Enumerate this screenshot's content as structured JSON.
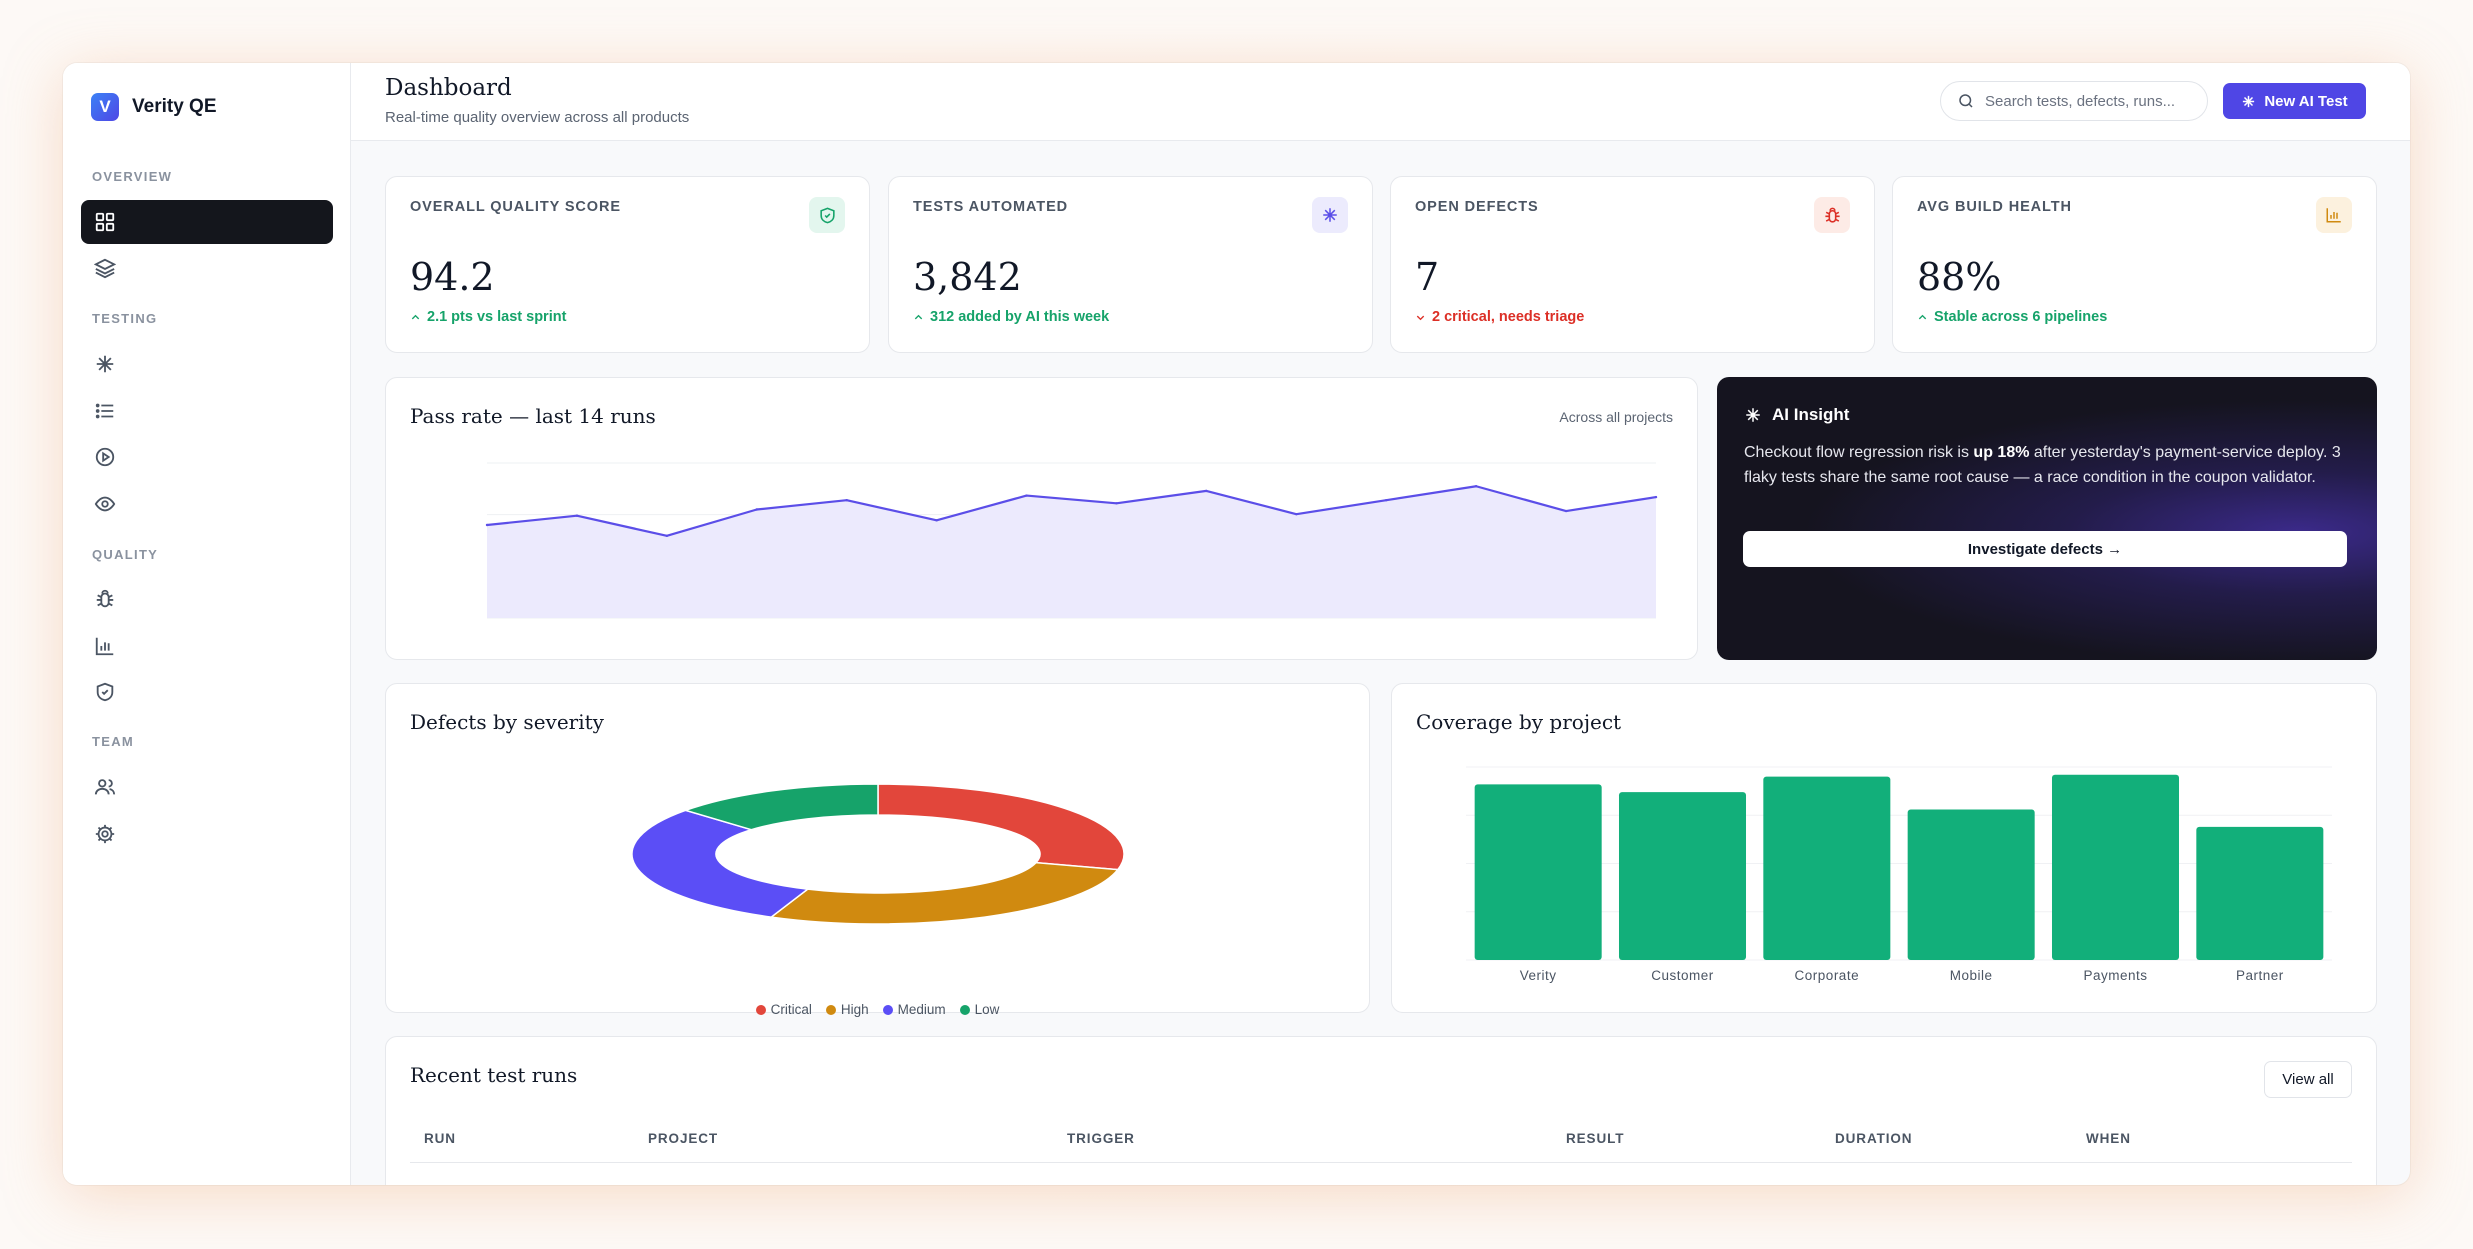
{
  "brand": {
    "name": "Verity QE",
    "logo_letter": "V"
  },
  "sidebar": {
    "sections": [
      {
        "label": "OVERVIEW"
      },
      {
        "label": "TESTING"
      },
      {
        "label": "QUALITY"
      },
      {
        "label": "TEAM"
      }
    ],
    "items": [
      {
        "icon": "grid-icon",
        "active": true
      },
      {
        "icon": "layers-icon"
      },
      {
        "icon": "sparkle-icon"
      },
      {
        "icon": "list-icon"
      },
      {
        "icon": "play-circle-icon"
      },
      {
        "icon": "eye-icon"
      },
      {
        "icon": "bug-icon"
      },
      {
        "icon": "bar-chart-icon"
      },
      {
        "icon": "shield-check-icon"
      },
      {
        "icon": "users-icon"
      },
      {
        "icon": "gear-icon"
      }
    ]
  },
  "header": {
    "title": "Dashboard",
    "subtitle": "Real-time quality overview across all products",
    "search_placeholder": "Search tests, defects, runs...",
    "new_button": "New AI Test"
  },
  "kpis": [
    {
      "label": "OVERALL QUALITY SCORE",
      "value": "94.2",
      "delta": "2.1 pts vs last sprint",
      "trend": "up",
      "icon": "shield-check-icon",
      "icon_color": "#16a36a",
      "icon_bg": "#e3f6ee"
    },
    {
      "label": "TESTS AUTOMATED",
      "value": "3,842",
      "delta": "312 added by AI this week",
      "trend": "up",
      "icon": "sparkle-icon",
      "icon_color": "#5b4ee8",
      "icon_bg": "#ecebfd"
    },
    {
      "label": "OPEN DEFECTS",
      "value": "7",
      "delta": "2 critical, needs triage",
      "trend": "down",
      "icon": "bug-icon",
      "icon_color": "#dc2f26",
      "icon_bg": "#fdebe6"
    },
    {
      "label": "AVG BUILD HEALTH",
      "value": "88%",
      "delta": "Stable across 6 pipelines",
      "trend": "up",
      "icon": "bar-chart-icon",
      "icon_color": "#d08a10",
      "icon_bg": "#fcf1de"
    }
  ],
  "pass_rate": {
    "title": "Pass rate — last 14 runs",
    "meta": "Across all projects"
  },
  "insight": {
    "title": "AI Insight",
    "body_pre": "Checkout flow regression risk is ",
    "body_bold": "up 18%",
    "body_post": " after yesterday's payment-service deploy. 3 flaky tests share the same root cause — a race condition in the coupon validator.",
    "button": "Investigate defects →"
  },
  "defects": {
    "title": "Defects by severity"
  },
  "coverage": {
    "title": "Coverage by project"
  },
  "recent_runs": {
    "title": "Recent test runs",
    "view_all": "View all",
    "columns": [
      "RUN",
      "PROJECT",
      "TRIGGER",
      "RESULT",
      "DURATION",
      "WHEN"
    ]
  },
  "chart_data": [
    {
      "type": "area",
      "title": "Pass rate — last 14 runs",
      "x": [
        1,
        2,
        3,
        4,
        5,
        6,
        7,
        8,
        9,
        10,
        11,
        12,
        13,
        14
      ],
      "series": [
        {
          "values": [
            92.0,
            93.2,
            90.6,
            94.0,
            95.2,
            92.6,
            95.8,
            94.8,
            96.4,
            93.4,
            95.2,
            97.0,
            93.8,
            95.6
          ]
        }
      ],
      "ylim": [
        80,
        100
      ],
      "grid": true,
      "color": "#5b4ee8",
      "fill": "#eceafd"
    },
    {
      "type": "pie",
      "title": "Defects by severity",
      "categories": [
        "Critical",
        "High",
        "Medium",
        "Low"
      ],
      "values": [
        2,
        2,
        2,
        1
      ],
      "colors": [
        "#e2463b",
        "#d08a10",
        "#5b4ef6",
        "#16a36a"
      ],
      "donut": true,
      "legend": "bottom"
    },
    {
      "type": "bar",
      "title": "Coverage by project",
      "categories": [
        "Verity",
        "Customer",
        "Corporate",
        "Mobile",
        "Payments",
        "Partner"
      ],
      "values": [
        91,
        87,
        95,
        78,
        96,
        69
      ],
      "ylim": [
        0,
        100
      ],
      "grid": true,
      "color": "#12af7a"
    }
  ]
}
